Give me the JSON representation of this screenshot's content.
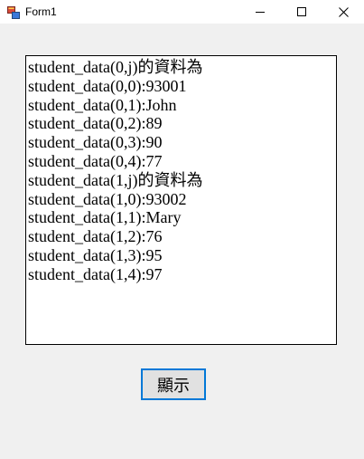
{
  "window": {
    "title": "Form1",
    "icon": "winforms-app-icon",
    "controls": [
      "minimize-icon",
      "maximize-icon",
      "close-icon"
    ]
  },
  "listbox": {
    "items": [
      "student_data(0,j)的資料為",
      "student_data(0,0):93001",
      "student_data(0,1):John",
      "student_data(0,2):89",
      "student_data(0,3):90",
      "student_data(0,4):77",
      "student_data(1,j)的資料為",
      "student_data(1,0):93002",
      "student_data(1,1):Mary",
      "student_data(1,2):76",
      "student_data(1,3):95",
      "student_data(1,4):97"
    ]
  },
  "button": {
    "label": "顯示",
    "border_color": "#0078d7"
  }
}
